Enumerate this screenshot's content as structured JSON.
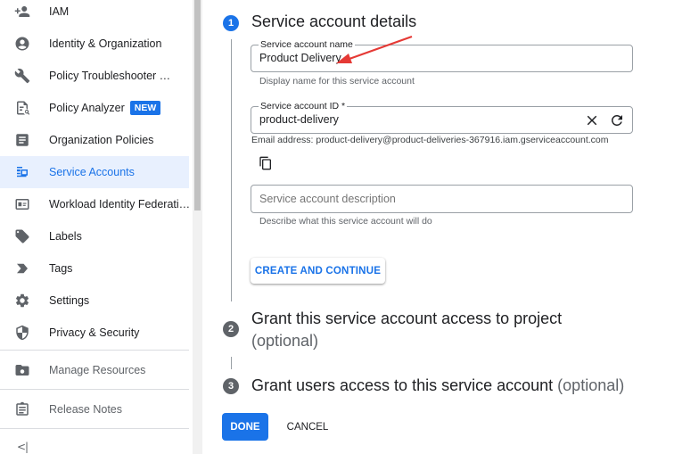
{
  "sidebar": {
    "items": [
      {
        "label": "IAM",
        "icon": "add-person-icon"
      },
      {
        "label": "Identity & Organization",
        "icon": "account-circle-icon"
      },
      {
        "label": "Policy Troubleshooter …",
        "icon": "wrench-icon"
      },
      {
        "label": "Policy Analyzer",
        "icon": "policy-analyzer-icon",
        "badge": "NEW"
      },
      {
        "label": "Organization Policies",
        "icon": "document-icon"
      },
      {
        "label": "Service Accounts",
        "icon": "service-account-icon",
        "active": true
      },
      {
        "label": "Workload Identity Federati…",
        "icon": "id-card-icon"
      },
      {
        "label": "Labels",
        "icon": "label-icon"
      },
      {
        "label": "Tags",
        "icon": "tag-chevron-icon"
      },
      {
        "label": "Settings",
        "icon": "gear-icon"
      },
      {
        "label": "Privacy & Security",
        "icon": "shield-icon"
      }
    ],
    "secondary": [
      {
        "label": "Manage Resources",
        "icon": "folder-settings-icon"
      },
      {
        "label": "Release Notes",
        "icon": "release-notes-icon"
      }
    ],
    "collapse_label": "<|"
  },
  "steps": [
    {
      "number": "1",
      "title": "Service account details"
    },
    {
      "number": "2",
      "title": "Grant this service account access to project",
      "optional": "(optional)"
    },
    {
      "number": "3",
      "title": "Grant users access to this service account",
      "optional": "(optional)"
    }
  ],
  "form": {
    "name": {
      "label": "Service account name",
      "value": "Product Delivery",
      "hint": "Display name for this service account"
    },
    "id": {
      "label": "Service account ID *",
      "value": "product-delivery"
    },
    "email": "Email address: product-delivery@product-deliveries-367916.iam.gserviceaccount.com",
    "description": {
      "placeholder": "Service account description",
      "hint": "Describe what this service account will do"
    }
  },
  "buttons": {
    "create": "CREATE AND CONTINUE",
    "done": "DONE",
    "cancel": "CANCEL"
  },
  "colors": {
    "accent": "#1a73e8",
    "active_bg": "#e8f0fe",
    "annotation_arrow": "#e53935"
  }
}
